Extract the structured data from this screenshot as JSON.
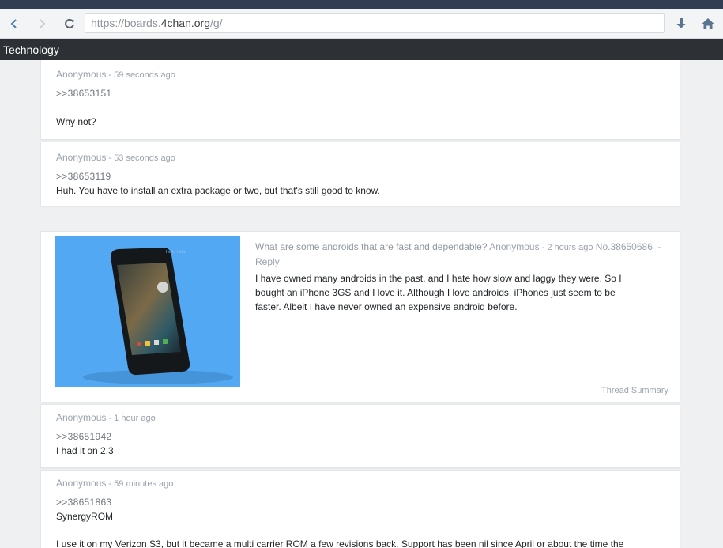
{
  "browser": {
    "url_prefix": "https://boards.",
    "url_host": "4chan.org",
    "url_suffix": "/g/"
  },
  "board": {
    "title": "Technology"
  },
  "posts": [
    {
      "author": "Anonymous",
      "time": " - 59 seconds ago",
      "quote": ">>38653151",
      "text": "Why not?"
    },
    {
      "author": "Anonymous",
      "time": " - 53 seconds ago",
      "quote": ">>38653119",
      "text": "Huh. You have to install an extra package or two, but that's still good to know."
    }
  ],
  "op": {
    "subject": "What are some androids that are fast and dependable?",
    "author": "Anonymous",
    "time": " - 2 hours ago",
    "number": "No.38650686",
    "reply_label": "Reply",
    "lines": [
      "I have owned many androids in the past, and I hate how slow and laggy they were. So I",
      "bought an iPhone 3GS and I love it. Although I love androids, iPhones just seem to be",
      "faster. Albeit I have never owned an expensive android before."
    ],
    "thread_summary": "Thread Summary",
    "image_caption": "hello hello"
  },
  "replies": [
    {
      "author": "Anonymous",
      "time": " - 1 hour ago",
      "quote": ">>38651942",
      "text": "I had it on 2.3"
    },
    {
      "author": "Anonymous",
      "time": " - 59 minutes ago",
      "quote": ">>38651863",
      "text": "SynergyROM",
      "text2": "I use it on my Verizon S3, but it became a multi carrier ROM a few revisions back. Support has been nil since April or about the time the"
    }
  ],
  "colors": {
    "accent": "#52a8f2",
    "topbar": "#2d3136",
    "meta": "#9aa3ad"
  }
}
